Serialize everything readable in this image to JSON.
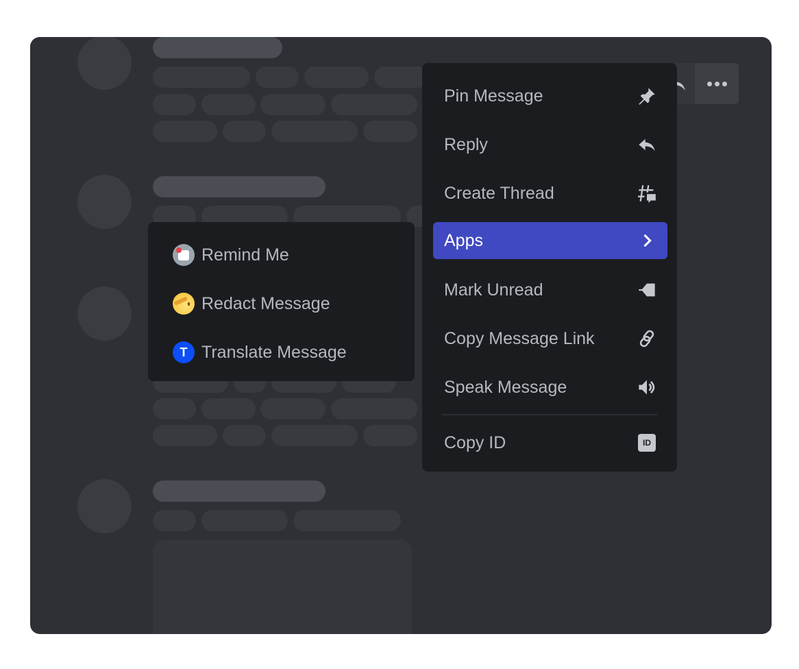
{
  "message_toolbar": {
    "more_icon": "ellipsis-icon",
    "reply_icon": "reply-icon"
  },
  "context_menu": {
    "items": [
      {
        "label": "Pin Message",
        "icon": "pin-icon"
      },
      {
        "label": "Reply",
        "icon": "reply-arrow-icon"
      },
      {
        "label": "Create Thread",
        "icon": "thread-icon"
      },
      {
        "label": "Apps",
        "icon": "chevron-right-icon",
        "active": true
      },
      {
        "label": "Mark Unread",
        "icon": "mark-unread-icon"
      },
      {
        "label": "Copy Message Link",
        "icon": "link-icon"
      },
      {
        "label": "Speak Message",
        "icon": "speaker-icon"
      },
      {
        "label": "Copy ID",
        "icon": "id-badge-icon",
        "icon_text": "ID"
      }
    ],
    "accent_color": "#4049c1"
  },
  "apps_submenu": {
    "items": [
      {
        "label": "Remind Me",
        "icon": "remind-me-app-icon"
      },
      {
        "label": "Redact Message",
        "icon": "redact-app-icon"
      },
      {
        "label": "Translate Message",
        "icon": "translate-app-icon",
        "icon_text": "T"
      }
    ]
  }
}
